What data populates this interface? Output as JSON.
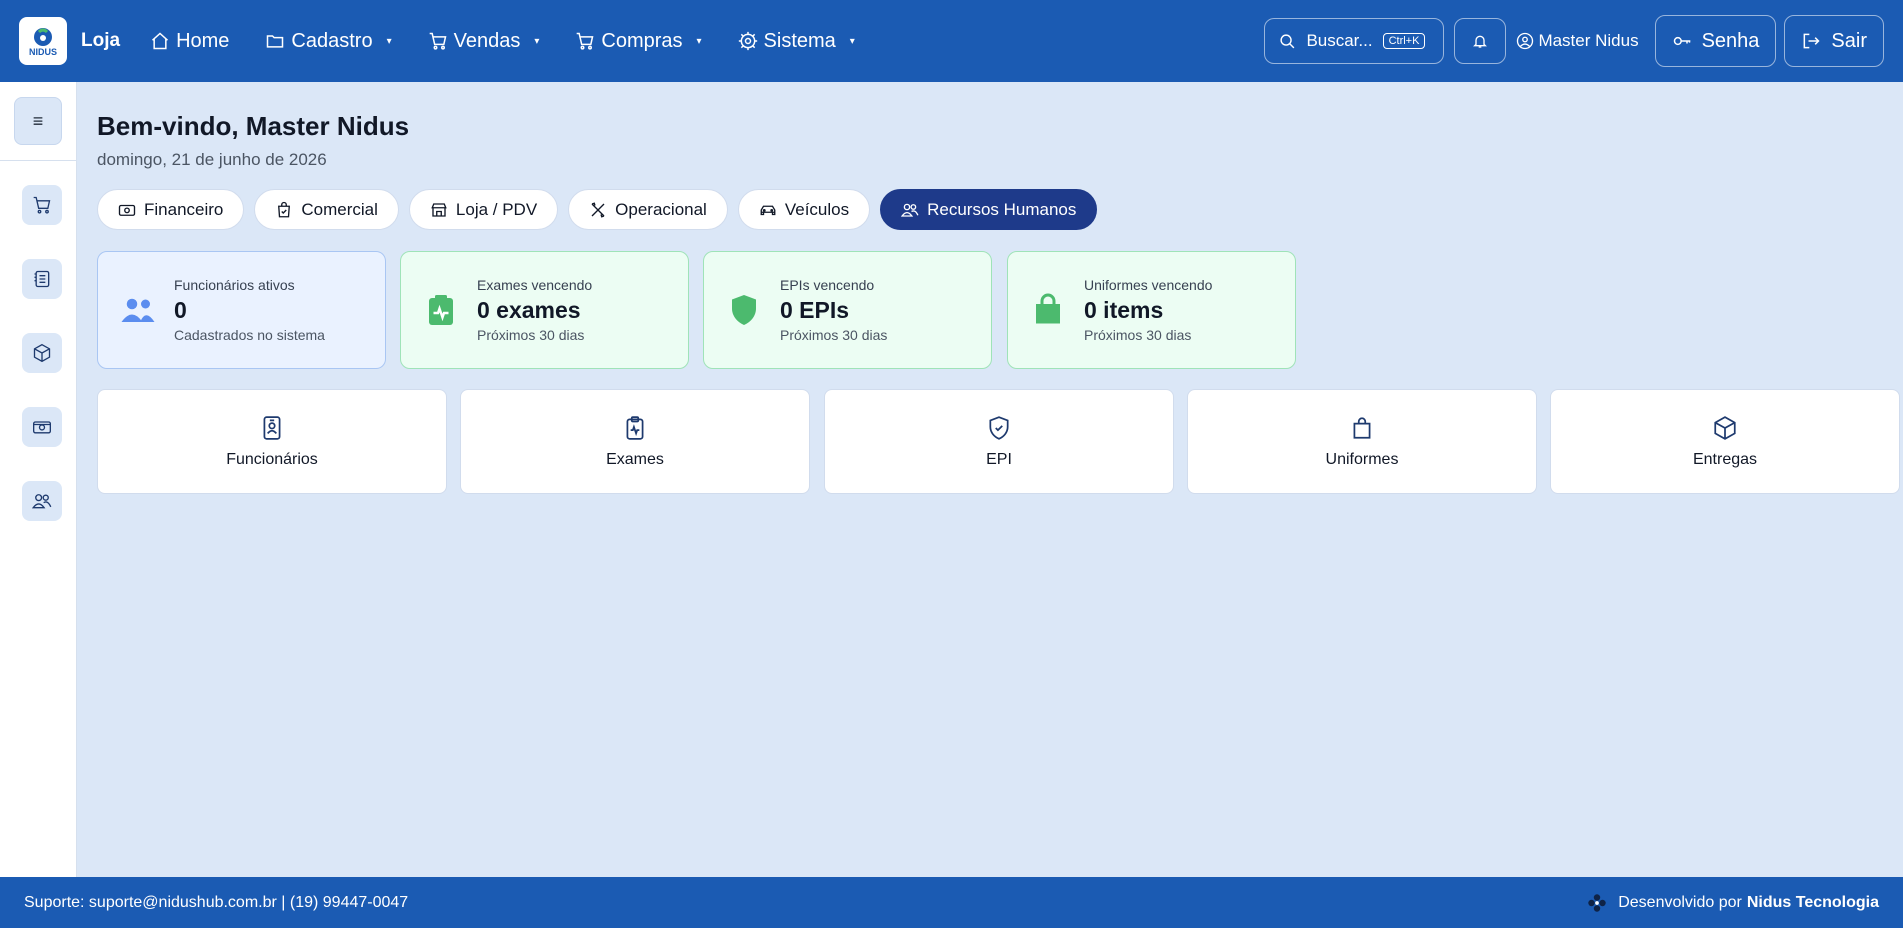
{
  "header": {
    "brand": "Loja",
    "logo_text": "NIDUS",
    "nav": [
      {
        "label": "Home",
        "icon": "home-icon"
      },
      {
        "label": "Cadastro",
        "icon": "folder-icon",
        "caret": "▾"
      },
      {
        "label": "Vendas",
        "icon": "cart-icon",
        "caret": "▾"
      },
      {
        "label": "Compras",
        "icon": "cart-icon",
        "caret": "▾"
      },
      {
        "label": "Sistema",
        "icon": "gear-icon",
        "caret": "▾"
      }
    ],
    "search": {
      "label": "Buscar...",
      "shortcut": "Ctrl+K"
    },
    "user_name": "Master Nidus",
    "password_label": "Senha",
    "logout_label": "Sair"
  },
  "sidebar": {
    "toggle_icon": "≡",
    "items": [
      "cart-icon",
      "list-icon",
      "box-icon",
      "cash-icon",
      "users-icon"
    ]
  },
  "main": {
    "welcome": "Bem-vindo, Master Nidus",
    "date": "domingo, 21 de junho de 2026",
    "tabs": [
      {
        "label": "Financeiro",
        "active": false
      },
      {
        "label": "Comercial",
        "active": false
      },
      {
        "label": "Loja / PDV",
        "active": false
      },
      {
        "label": "Operacional",
        "active": false
      },
      {
        "label": "Veículos",
        "active": false
      },
      {
        "label": "Recursos Humanos",
        "active": true
      }
    ],
    "stats": [
      {
        "label": "Funcionários ativos",
        "value": "0",
        "sub": "Cadastrados no sistema",
        "color": "#5b8def"
      },
      {
        "label": "Exames vencendo",
        "value": "0 exames",
        "sub": "Próximos 30 dias",
        "color": "#4cba6e"
      },
      {
        "label": "EPIs vencendo",
        "value": "0 EPIs",
        "sub": "Próximos 30 dias",
        "color": "#4cba6e"
      },
      {
        "label": "Uniformes vencendo",
        "value": "0 items",
        "sub": "Próximos 30 dias",
        "color": "#4cba6e"
      }
    ],
    "shortcuts": [
      {
        "label": "Funcionários",
        "icon": "badge-icon"
      },
      {
        "label": "Exames",
        "icon": "clipboard-pulse-icon"
      },
      {
        "label": "EPI",
        "icon": "shield-check-icon"
      },
      {
        "label": "Uniformes",
        "icon": "bag-icon"
      },
      {
        "label": "Entregas",
        "icon": "box-icon"
      }
    ]
  },
  "footer": {
    "support": "Suporte: suporte@nidushub.com.br | (19) 99447-0047",
    "dev_prefix": "Desenvolvido por",
    "dev_name": "Nidus Tecnologia"
  },
  "colors": {
    "primary": "#1b5bb3",
    "active_tab": "#1e3a8a",
    "background": "#dbe7f7"
  }
}
